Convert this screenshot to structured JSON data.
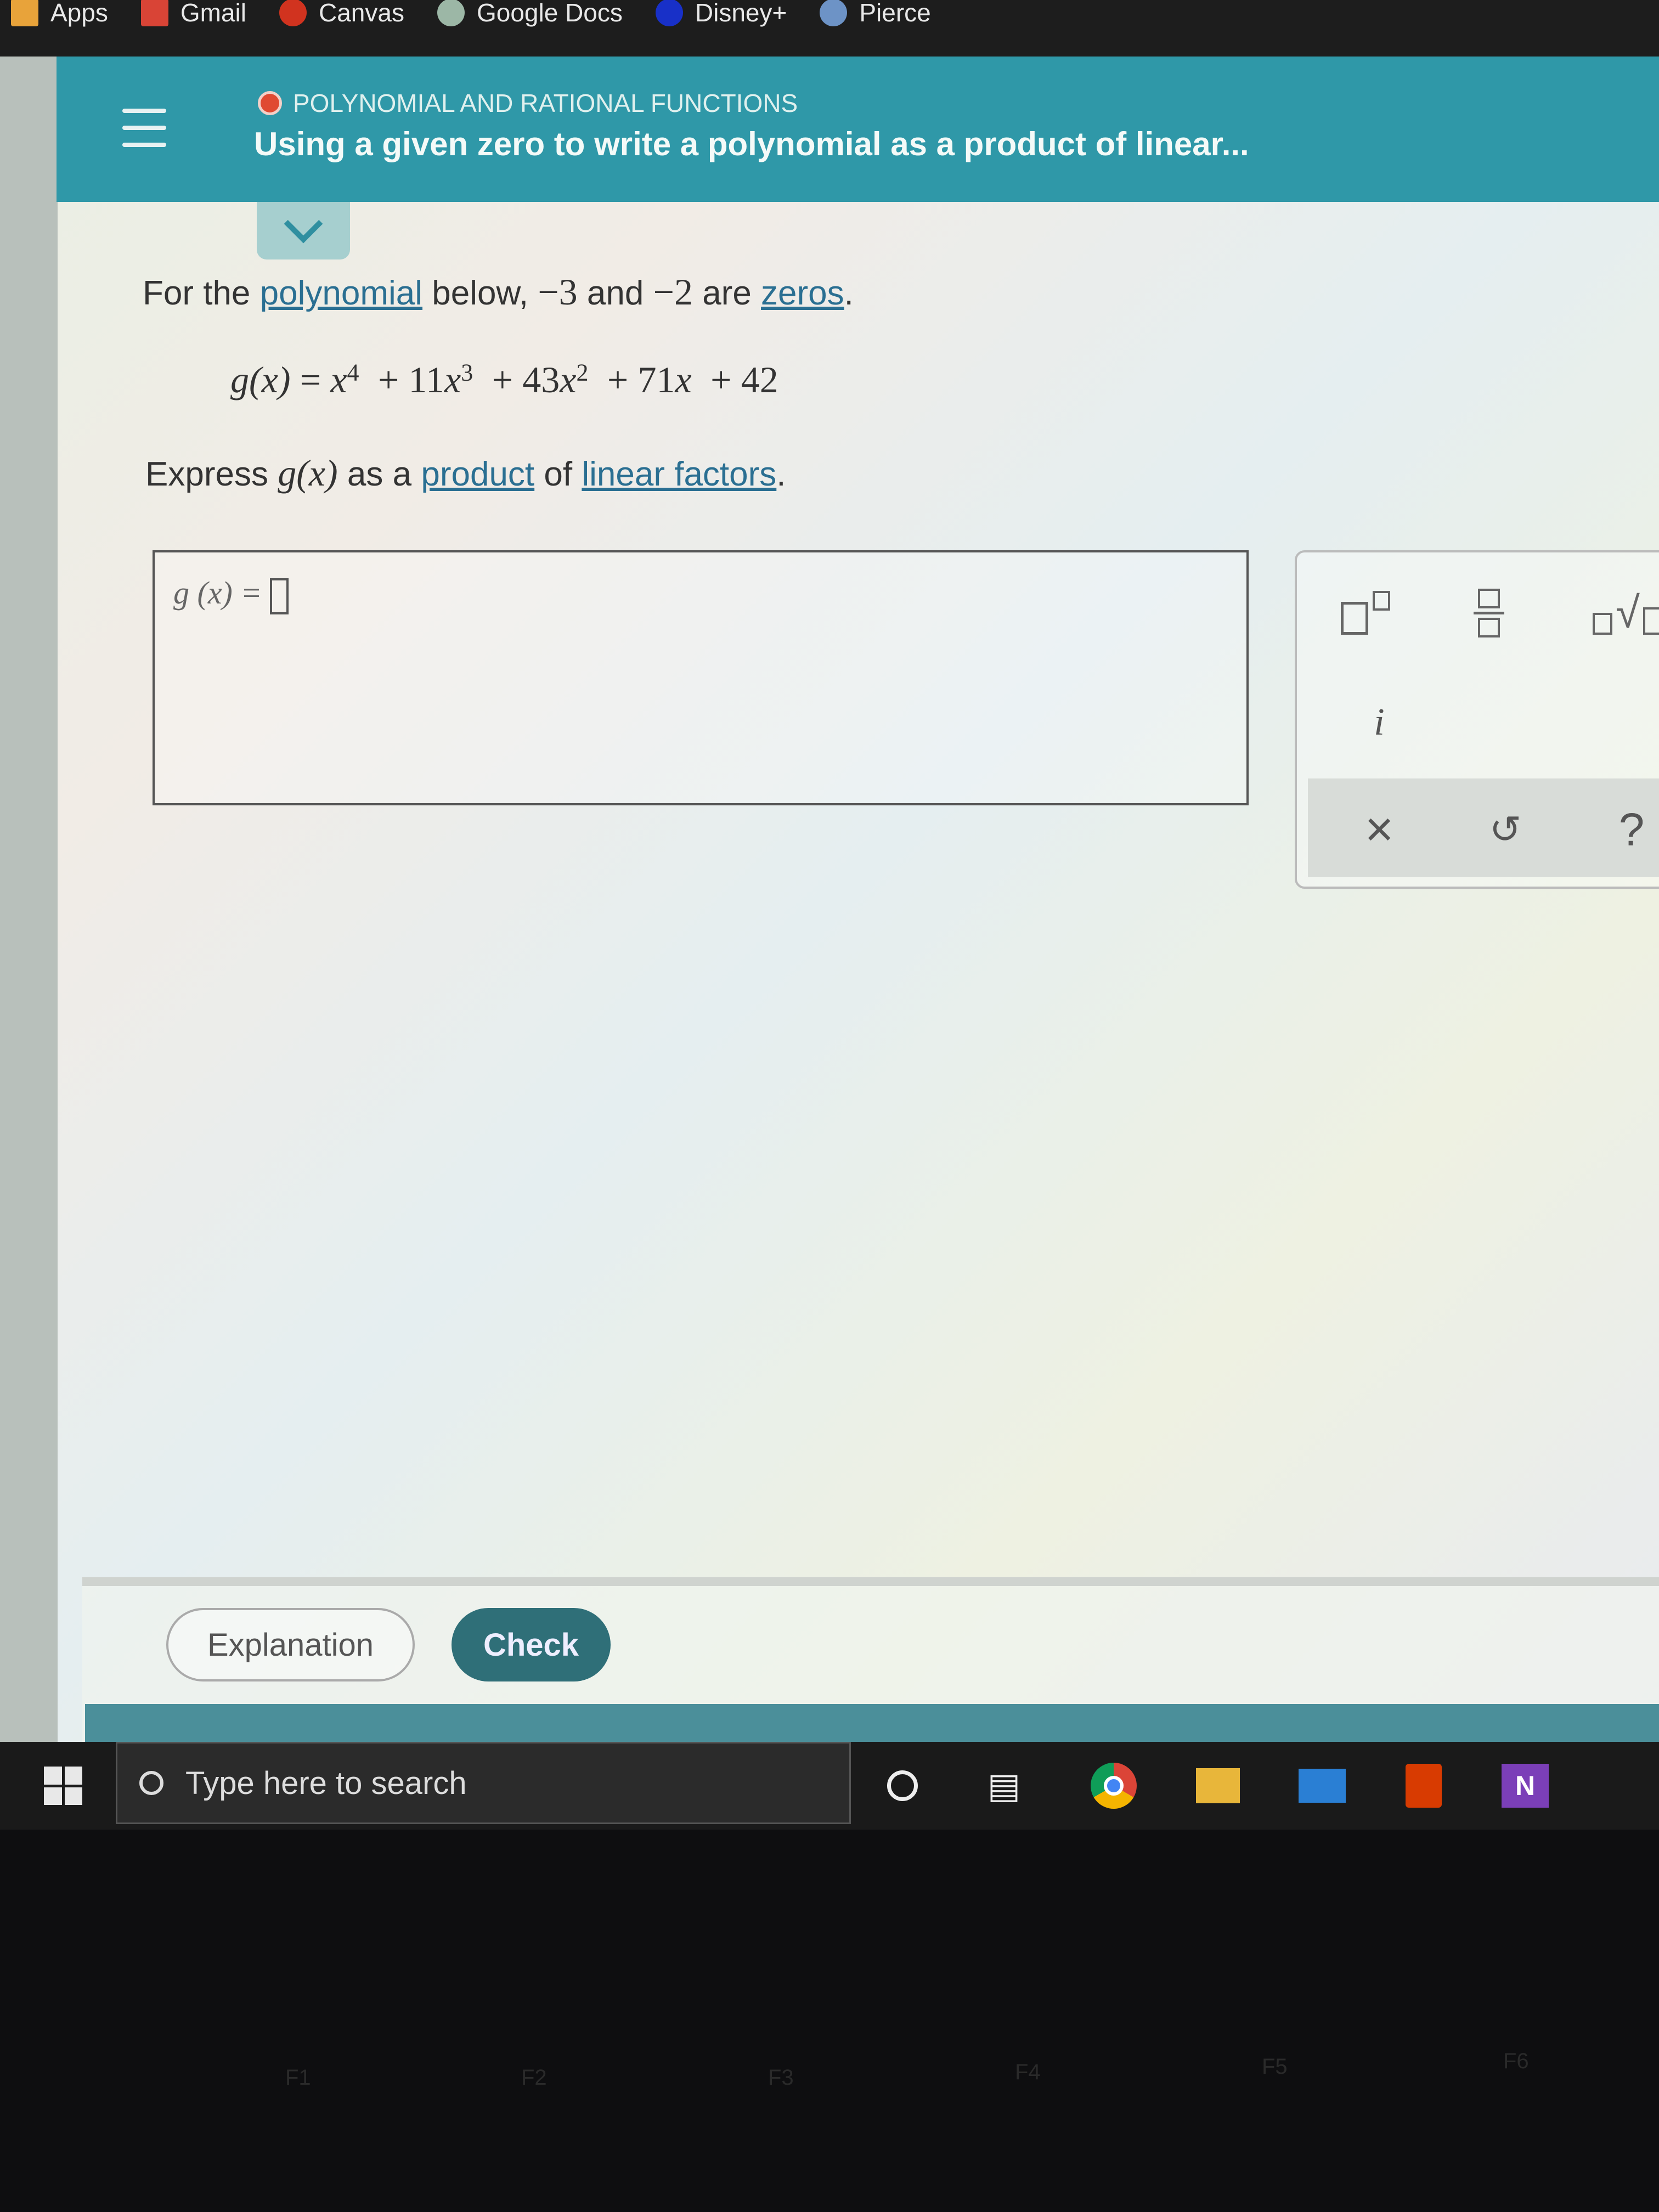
{
  "bookmarks": [
    {
      "label": "Apps",
      "icon": "apps-grid-icon",
      "color": "#e8a33a"
    },
    {
      "label": "Gmail",
      "icon": "gmail-icon",
      "color": "#d94436"
    },
    {
      "label": "Canvas",
      "icon": "canvas-icon",
      "color": "#d1331f"
    },
    {
      "label": "Google Docs",
      "icon": "google-docs-icon",
      "color": "#9cb7a6"
    },
    {
      "label": "Disney+",
      "icon": "disney-plus-icon",
      "color": "#1830c8"
    },
    {
      "label": "Pierce",
      "icon": "pierce-icon",
      "color": "#6d93c6"
    }
  ],
  "header": {
    "category": "POLYNOMIAL AND RATIONAL FUNCTIONS",
    "title": "Using a given zero to write a polynomial as a product of linear...",
    "accent": "#2f98a8",
    "status_dot_color": "#e04a32"
  },
  "problem": {
    "intro_pre": "For the",
    "intro_link1": "polynomial",
    "intro_mid": "below,",
    "zero1": "−3",
    "and": "and",
    "zero2": "−2",
    "are": "are",
    "intro_link2": "zeros",
    "period": ".",
    "equation": {
      "lhs": "g",
      "arg": "(x)",
      "eq": "=",
      "terms": [
        {
          "coef": "",
          "var": "x",
          "exp": "4",
          "op": ""
        },
        {
          "coef": "11",
          "var": "x",
          "exp": "3",
          "op": "+"
        },
        {
          "coef": "43",
          "var": "x",
          "exp": "2",
          "op": "+"
        },
        {
          "coef": "71",
          "var": "x",
          "exp": "",
          "op": "+"
        },
        {
          "coef": "42",
          "var": "",
          "exp": "",
          "op": "+"
        }
      ]
    },
    "express_pre": "Express",
    "express_fn": "g",
    "express_arg": "(x)",
    "express_mid": "as a",
    "express_link1": "product",
    "express_of": "of",
    "express_link2": "linear factors",
    "express_end": "."
  },
  "answer": {
    "label": "g (x) ="
  },
  "toolbox": {
    "imag": "i",
    "clear": "×",
    "undo": "↺",
    "help": "?"
  },
  "footer": {
    "explanation": "Explanation",
    "check": "Check"
  },
  "taskbar": {
    "search_placeholder": "Type here to search"
  },
  "keyboard": [
    "F1",
    "F2",
    "F3",
    "F4",
    "F5",
    "F6"
  ]
}
